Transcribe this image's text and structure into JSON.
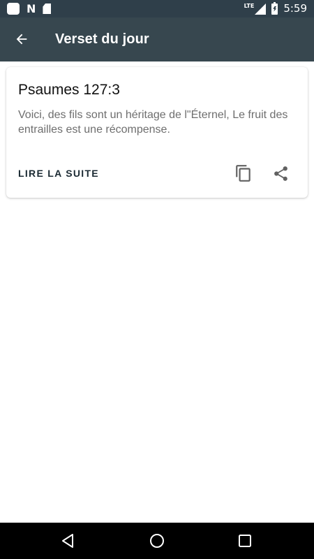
{
  "status_bar": {
    "network_label": "LTE",
    "time": "5:59",
    "icons": [
      "app-notification-icon",
      "n-notification-icon",
      "sd-card-icon",
      "signal-icon",
      "battery-charging-icon"
    ]
  },
  "app_bar": {
    "title": "Verset du jour",
    "back_icon": "arrow-back-icon"
  },
  "verse_card": {
    "reference": "Psaumes 127:3",
    "text": "Voici, des fils sont un héritage de l\"Éternel, Le fruit des entrailles est une récompense.",
    "read_more_label": "LIRE LA SUITE",
    "copy_icon": "copy-icon",
    "share_icon": "share-icon"
  },
  "nav_bar": {
    "icons": [
      "nav-back-icon",
      "nav-home-icon",
      "nav-recents-icon"
    ]
  },
  "colors": {
    "status_bar": "#2f3f4a",
    "app_bar": "#37474f",
    "card_text": "#6e6e6e",
    "button_text": "#1b2a33",
    "icon_gray": "#616161"
  }
}
